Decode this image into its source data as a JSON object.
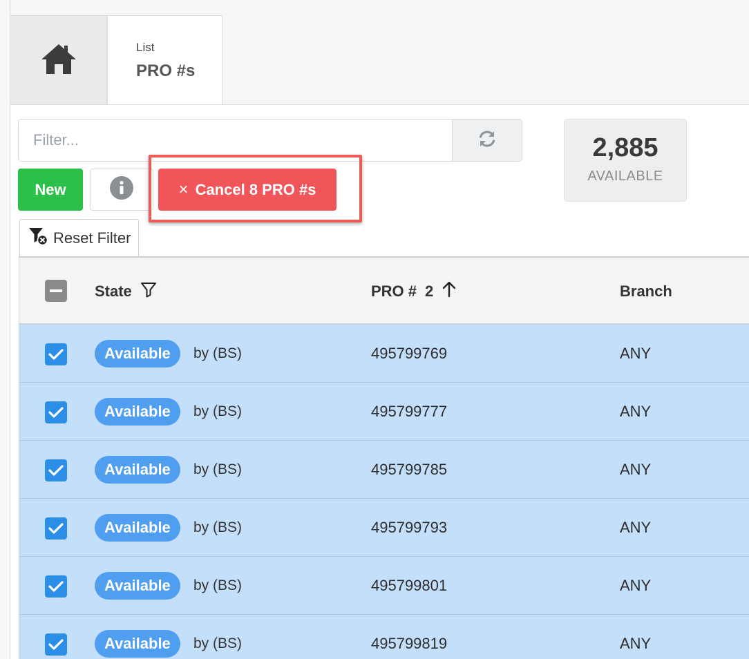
{
  "tabs": {
    "home_icon": "home-icon",
    "list_small": "List",
    "list_title": "PRO #s"
  },
  "filter": {
    "placeholder": "Filter...",
    "refresh_icon": "refresh-icon"
  },
  "counter": {
    "value": "2,885",
    "label": "AVAILABLE"
  },
  "toolbar": {
    "new_label": "New",
    "info_icon": "info-icon",
    "cancel_label": "Cancel 8 PRO #s",
    "cancel_icon": "×",
    "reset_filter_label": "Reset Filter"
  },
  "table": {
    "headers": {
      "state": "State",
      "pro": "PRO #",
      "pro_sort_order": "2",
      "branch": "Branch"
    },
    "rows": [
      {
        "state": "Available",
        "by": "by (BS)",
        "pro": "495799769",
        "branch": "ANY",
        "checked": true
      },
      {
        "state": "Available",
        "by": "by (BS)",
        "pro": "495799777",
        "branch": "ANY",
        "checked": true
      },
      {
        "state": "Available",
        "by": "by (BS)",
        "pro": "495799785",
        "branch": "ANY",
        "checked": true
      },
      {
        "state": "Available",
        "by": "by (BS)",
        "pro": "495799793",
        "branch": "ANY",
        "checked": true
      },
      {
        "state": "Available",
        "by": "by (BS)",
        "pro": "495799801",
        "branch": "ANY",
        "checked": true
      },
      {
        "state": "Available",
        "by": "by (BS)",
        "pro": "495799819",
        "branch": "ANY",
        "checked": true
      }
    ]
  },
  "colors": {
    "new_button": "#2cbf4a",
    "cancel_button": "#f0555a",
    "badge": "#4f9ef0",
    "selected_row": "#c3dffa",
    "checkbox": "#2b8fe8"
  }
}
